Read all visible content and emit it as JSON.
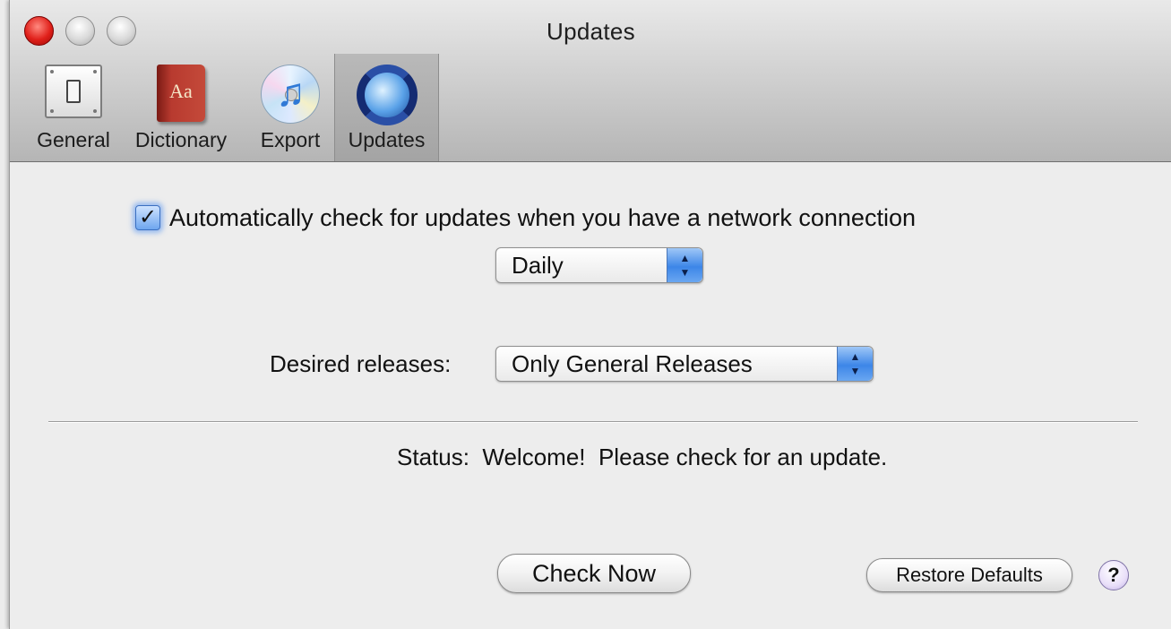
{
  "window": {
    "title": "Updates"
  },
  "toolbar": {
    "items": [
      {
        "label": "General",
        "icon": "toggle-switch-icon",
        "selected": false
      },
      {
        "label": "Dictionary",
        "icon": "dictionary-book-icon",
        "icon_text": "Aa",
        "selected": false
      },
      {
        "label": "Export",
        "icon": "itunes-cd-icon",
        "icon_text": "♫",
        "selected": false
      },
      {
        "label": "Updates",
        "icon": "software-update-icon",
        "selected": true
      }
    ]
  },
  "updates": {
    "auto_check_label": "Automatically check for updates when you have a network connection",
    "auto_check_checked": true,
    "check_mark": "✓",
    "frequency_value": "Daily",
    "desired_releases_label": "Desired releases:",
    "desired_releases_value": "Only General Releases",
    "status_label": "Status:",
    "status_text": "Welcome!  Please check for an update.",
    "check_now_label": "Check Now",
    "restore_defaults_label": "Restore Defaults",
    "help_label": "?"
  },
  "colors": {
    "accent": "#3d86e8",
    "close_button": "#e0201a",
    "help_button": "#e9dff9"
  }
}
